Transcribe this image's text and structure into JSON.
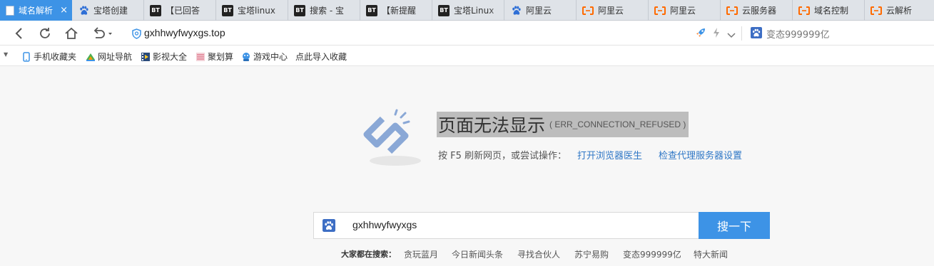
{
  "tabs": [
    {
      "label": "域名解析",
      "icon": "document-icon",
      "active": true
    },
    {
      "label": "宝塔创建",
      "icon": "baidu-paw-icon"
    },
    {
      "label": "【已回答",
      "icon": "bt-icon"
    },
    {
      "label": "宝塔linux",
      "icon": "bt-icon"
    },
    {
      "label": "搜索 - 宝",
      "icon": "bt-icon"
    },
    {
      "label": "【新提醒",
      "icon": "bt-icon"
    },
    {
      "label": "宝塔Linux",
      "icon": "bt-icon"
    },
    {
      "label": "阿里云",
      "icon": "baidu-paw-icon"
    },
    {
      "label": "阿里云",
      "icon": "aliyun-icon"
    },
    {
      "label": "阿里云",
      "icon": "aliyun-icon"
    },
    {
      "label": "云服务器",
      "icon": "aliyun-icon"
    },
    {
      "label": "域名控制",
      "icon": "aliyun-icon"
    },
    {
      "label": "云解析",
      "icon": "aliyun-icon"
    }
  ],
  "tab_close_glyph": "×",
  "address": {
    "url": "gxhhwyfwyxgs.top",
    "search_suggestion": "变态999999亿"
  },
  "bookmarks": [
    {
      "label": "手机收藏夹",
      "icon": "phone-icon"
    },
    {
      "label": "网址导航",
      "icon": "navigation-icon"
    },
    {
      "label": "影视大全",
      "icon": "film-icon"
    },
    {
      "label": "聚划算",
      "icon": "juhuasuan-icon"
    },
    {
      "label": "游戏中心",
      "icon": "game-icon"
    },
    {
      "label": "点此导入收藏",
      "icon": ""
    }
  ],
  "error": {
    "title": "页面无法显示",
    "code": "( ERR_CONNECTION_REFUSED )",
    "hint": "按 F5 刷新网页，或尝试操作：",
    "link1": "打开浏览器医生",
    "link2": "检查代理服务器设置"
  },
  "search": {
    "value": "gxhhwyfwyxgs",
    "button": "搜一下",
    "hot_label": "大家都在搜索：",
    "hot_items": [
      "贪玩蓝月",
      "今日新闻头条",
      "寻找合伙人",
      "苏宁易购",
      "变态999999亿",
      "特大新闻"
    ]
  },
  "colors": {
    "accent": "#3d93e6",
    "link": "#2f77c6",
    "aliyun_orange": "#ff6a00",
    "highlight": "#bdbdbd"
  }
}
